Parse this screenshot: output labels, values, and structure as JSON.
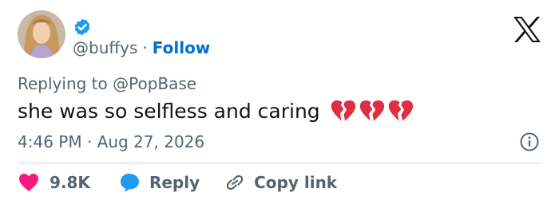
{
  "author": {
    "handle": "@buffys",
    "separator": "·",
    "follow_label": "Follow",
    "verified": true
  },
  "tweet": {
    "replying_to": "Replying to @PopBase",
    "text": "she was so selfless and caring",
    "emoji": [
      "broken-heart",
      "broken-heart",
      "broken-heart"
    ],
    "timestamp": "4:46 PM · Aug 27, 2026"
  },
  "actions": {
    "like_count": "9.8K",
    "reply_label": "Reply",
    "copy_label": "Copy link"
  },
  "icons": {
    "brand": "x-logo",
    "verified": "verified-badge-icon",
    "info": "info-icon",
    "like": "heart-icon",
    "reply": "speech-bubble-icon",
    "copy": "link-icon"
  },
  "colors": {
    "verified_blue": "#1d9bf0",
    "follow_blue": "#006fd6",
    "like_pink": "#f91880",
    "muted_text": "#536471",
    "heart_red": "#dd2e44",
    "divider": "#cfd9de"
  }
}
